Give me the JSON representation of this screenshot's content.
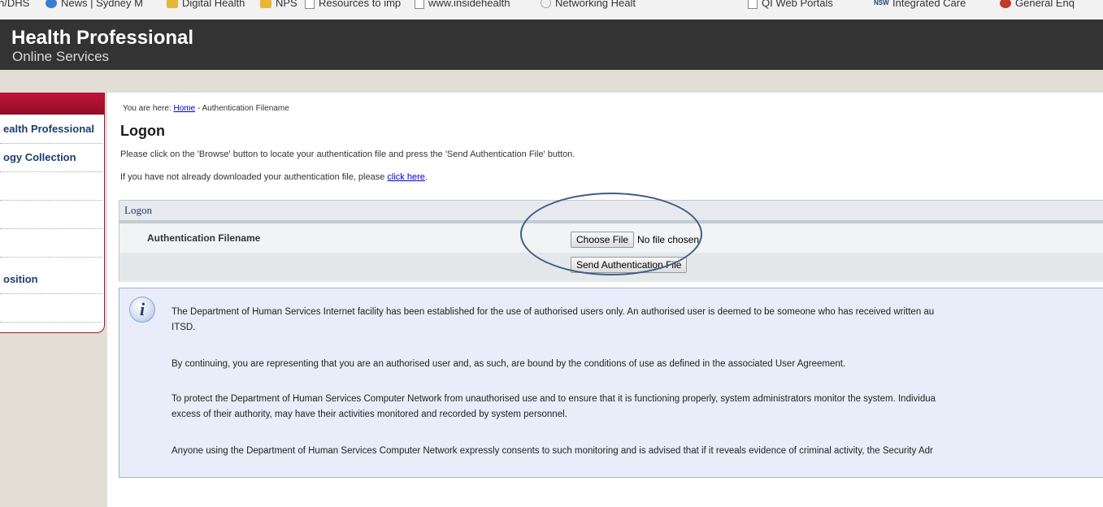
{
  "bookmarks": [
    {
      "label": "n/DHS",
      "icon": "none",
      "faded": false
    },
    {
      "label": "News | Sydney M",
      "icon": "globe-icon",
      "faded": false
    },
    {
      "label": "Digital Health",
      "icon": "folder-icon",
      "faded": false
    },
    {
      "label": "NPS",
      "icon": "folder-icon",
      "faded": false
    },
    {
      "label": "Resources to imp",
      "icon": "page-icon",
      "faded": false
    },
    {
      "label": "www.insidehealth",
      "icon": "page-icon",
      "faded": false
    },
    {
      "label": "Networking Healt",
      "icon": "circle-icon",
      "faded": false
    },
    {
      "label": "QI Web Portals",
      "icon": "page-icon",
      "faded": false
    },
    {
      "label": "Integrated Care",
      "icon": "nsw-icon",
      "faded": false
    },
    {
      "label": "General Enq",
      "icon": "red-circle-icon",
      "faded": false
    }
  ],
  "header": {
    "title": "Health Professional",
    "subtitle": "Online Services"
  },
  "sidebar": {
    "items": [
      {
        "label": "ealth Professional"
      },
      {
        "label": "ogy Collection"
      },
      {
        "label": ""
      },
      {
        "label": ""
      },
      {
        "label": ""
      },
      {
        "label": "osition"
      },
      {
        "label": ""
      }
    ]
  },
  "breadcrumb": {
    "prefix": "You are here:",
    "home": "Home",
    "current": "- Authentication Filename"
  },
  "page": {
    "title": "Logon",
    "instruction": "Please click on the 'Browse' button to locate your authentication file and press the 'Send Authentication File' button.",
    "download_prefix": "If you have not already downloaded your authentication file, please",
    "download_link": "click here",
    "download_suffix": "."
  },
  "form": {
    "header": "Logon",
    "field_label": "Authentication Filename",
    "choose_file_label": "Choose File",
    "no_file_text": "No file chosen",
    "send_button_label": "Send Authentication File"
  },
  "info": {
    "icon": "info-icon",
    "p1_line1": "The Department of Human Services Internet facility has been established for the use of authorised users only. An authorised user is deemed to be someone who has received written au",
    "p1_line2": "ITSD.",
    "p2": "By continuing, you are representing that you are an authorised user and, as such, are bound by the conditions of use as defined in the associated User Agreement.",
    "p3_line1": "To protect the Department of Human Services Computer Network from unauthorised use and to ensure that it is functioning properly, system administrators monitor the system. Individua",
    "p3_line2": "excess of their authority, may have their activities monitored and recorded by system personnel.",
    "p4": "Anyone using the Department of Human Services Computer Network expressly consents to such monitoring and is advised that if it reveals evidence of criminal activity, the Security Adr"
  },
  "colors": {
    "header_bg": "#333333",
    "accent_red": "#a0142e",
    "link_blue": "#0000cc",
    "menu_text": "#1f3b70",
    "info_bg": "#e8edf9",
    "annotation_oval": "#3e5d8a"
  }
}
